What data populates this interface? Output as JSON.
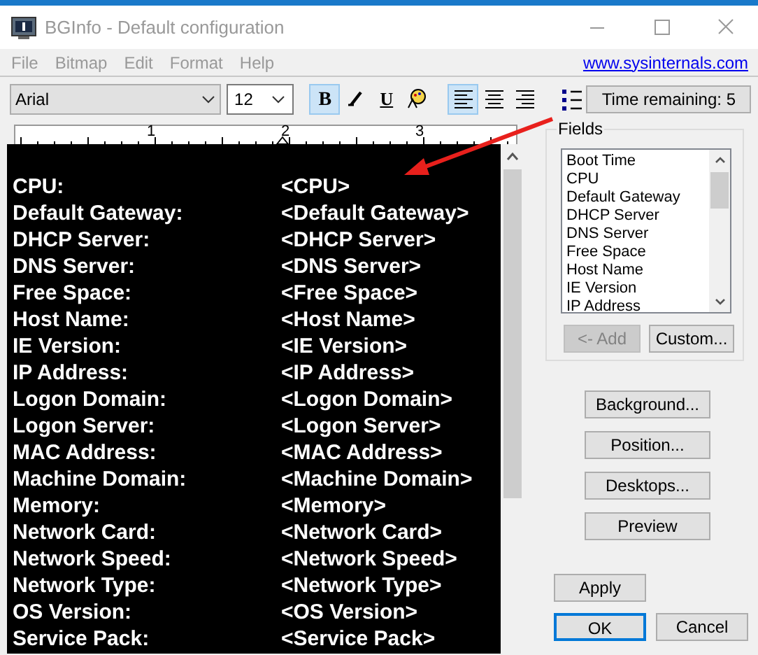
{
  "window": {
    "title": "BGInfo - Default configuration"
  },
  "menu": [
    "File",
    "Bitmap",
    "Edit",
    "Format",
    "Help"
  ],
  "link": "www.sysinternals.com",
  "toolbar": {
    "font": "Arial",
    "size": "12",
    "format_buttons": [
      {
        "kind": "bold",
        "label": "B",
        "selected": true
      },
      {
        "kind": "italic",
        "selected": false
      },
      {
        "kind": "underline",
        "label": "U",
        "selected": false
      },
      {
        "kind": "color",
        "selected": false
      },
      {
        "kind": "align-left",
        "selected": true
      },
      {
        "kind": "align-center",
        "selected": false
      },
      {
        "kind": "align-right",
        "selected": false
      },
      {
        "kind": "bullets",
        "selected": false
      }
    ],
    "timer": "Time remaining: 5"
  },
  "ruler": [
    "1",
    "2",
    "3"
  ],
  "editor": [
    {
      "label": "CPU:",
      "value": "<CPU>"
    },
    {
      "label": "Default Gateway:",
      "value": "<Default Gateway>"
    },
    {
      "label": "DHCP Server:",
      "value": "<DHCP Server>"
    },
    {
      "label": "DNS Server:",
      "value": "<DNS Server>"
    },
    {
      "label": "Free Space:",
      "value": "<Free Space>"
    },
    {
      "label": "Host Name:",
      "value": "<Host Name>"
    },
    {
      "label": "IE Version:",
      "value": "<IE Version>"
    },
    {
      "label": "IP Address:",
      "value": "<IP Address>"
    },
    {
      "label": "Logon Domain:",
      "value": "<Logon Domain>"
    },
    {
      "label": "Logon Server:",
      "value": "<Logon Server>"
    },
    {
      "label": "MAC Address:",
      "value": "<MAC Address>"
    },
    {
      "label": "Machine Domain:",
      "value": "<Machine Domain>"
    },
    {
      "label": "Memory:",
      "value": "<Memory>"
    },
    {
      "label": "Network Card:",
      "value": "<Network Card>"
    },
    {
      "label": "Network Speed:",
      "value": "<Network Speed>"
    },
    {
      "label": "Network Type:",
      "value": "<Network Type>"
    },
    {
      "label": "OS Version:",
      "value": "<OS Version>"
    },
    {
      "label": "Service Pack:",
      "value": "<Service Pack>"
    }
  ],
  "fields": {
    "title": "Fields",
    "items": [
      "Boot Time",
      "CPU",
      "Default Gateway",
      "DHCP Server",
      "DNS Server",
      "Free Space",
      "Host Name",
      "IE Version",
      "IP Address"
    ],
    "add_button": {
      "label": "<- Add",
      "disabled": true
    },
    "custom_button": {
      "label": "Custom...",
      "disabled": false
    }
  },
  "side_buttons": [
    "Background...",
    "Position...",
    "Desktops...",
    "Preview"
  ],
  "dialog_buttons": [
    {
      "label": "Apply",
      "default": false
    },
    {
      "label": "OK",
      "default": true
    },
    {
      "label": "Cancel",
      "default": false
    }
  ]
}
